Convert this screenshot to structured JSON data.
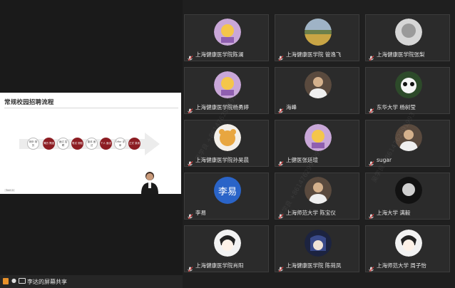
{
  "slide": {
    "title": "常规校园招聘流程",
    "footer_tag": "Tosh U",
    "steps": [
      {
        "label": "网申 简历",
        "style": "white"
      },
      {
        "label": "简历 筛选",
        "style": "red"
      },
      {
        "label": "面试 招聘",
        "style": "white"
      },
      {
        "label": "笔试 测验",
        "style": "red"
      },
      {
        "label": "集体 面试",
        "style": "white"
      },
      {
        "label": "个人 面试",
        "style": "red"
      },
      {
        "label": "Offer 评审",
        "style": "white"
      },
      {
        "label": "正式 录用",
        "style": "red"
      }
    ]
  },
  "bottom_bar": {
    "share_label": "李达的屏幕共享"
  },
  "participants": [
    {
      "name": "上海健康医学院陈澜",
      "avatar": "cartoon-avatar"
    },
    {
      "name": "上海健康医学院 管逸飞",
      "avatar": "landscape-avatar"
    },
    {
      "name": "上海健康医学院张梨",
      "avatar": "gray-avatar"
    },
    {
      "name": "上海健康医学院杨勇婷",
      "avatar": "cartoon-avatar"
    },
    {
      "name": "海峰",
      "avatar": "photo-avatar"
    },
    {
      "name": "东华大学 杨树莹",
      "avatar": "panda-avatar"
    },
    {
      "name": "上海健康医学院孙昊晨",
      "avatar": "bear-avatar"
    },
    {
      "name": "上健医张廷瑄",
      "avatar": "cartoon-avatar"
    },
    {
      "name": "sugar",
      "avatar": "photo-avatar"
    },
    {
      "name": "李易",
      "avatar_text": "李易"
    },
    {
      "name": "上海师范大学 陈宝仪",
      "avatar": "photo-avatar"
    },
    {
      "name": "上海大学 满毅",
      "avatar": "dark-avatar"
    },
    {
      "name": "上海健康医学院肖阳",
      "avatar": "sketch-avatar"
    },
    {
      "name": "上海健康医学院 陈荷凤",
      "avatar": "anime-avatar"
    },
    {
      "name": "上海师范大学 周子怡",
      "avatar": "sketch-avatar"
    }
  ],
  "watermark_text": "吴学良 +8614762991993"
}
